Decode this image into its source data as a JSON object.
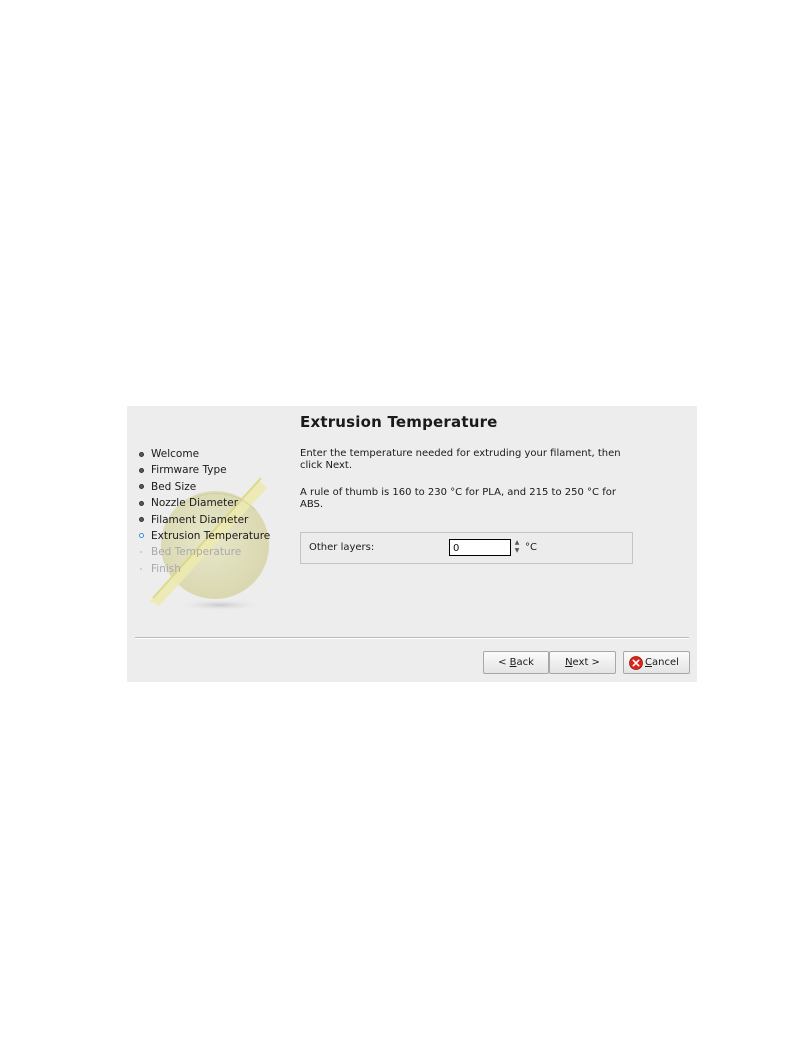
{
  "sidebar": {
    "steps": [
      {
        "label": "Welcome",
        "state": "done"
      },
      {
        "label": "Firmware Type",
        "state": "done"
      },
      {
        "label": "Bed Size",
        "state": "done"
      },
      {
        "label": "Nozzle Diameter",
        "state": "done"
      },
      {
        "label": "Filament Diameter",
        "state": "done"
      },
      {
        "label": "Extrusion Temperature",
        "state": "current"
      },
      {
        "label": "Bed Temperature",
        "state": "todo"
      },
      {
        "label": "Finish",
        "state": "todo"
      }
    ]
  },
  "page": {
    "title": "Extrusion Temperature",
    "description": "Enter the temperature needed for extruding your filament, then click Next.",
    "hint": "A rule of thumb is 160 to 230 °C for PLA, and 215 to 250 °C for ABS."
  },
  "temperature": {
    "label": "Other layers:",
    "value": "0",
    "unit": "°C"
  },
  "buttons": {
    "back_prefix": "< ",
    "back_accel": "B",
    "back_rest": "ack",
    "next_accel": "N",
    "next_rest": "ext >",
    "cancel_accel": "C",
    "cancel_rest": "ancel"
  },
  "colors": {
    "dialog_bg": "#ededed",
    "current_step_bullet": "#3a8bd8",
    "cancel_icon": "#d9261c"
  },
  "icons": {
    "logo": "slic3r-logo",
    "cancel": "cancel-icon"
  }
}
